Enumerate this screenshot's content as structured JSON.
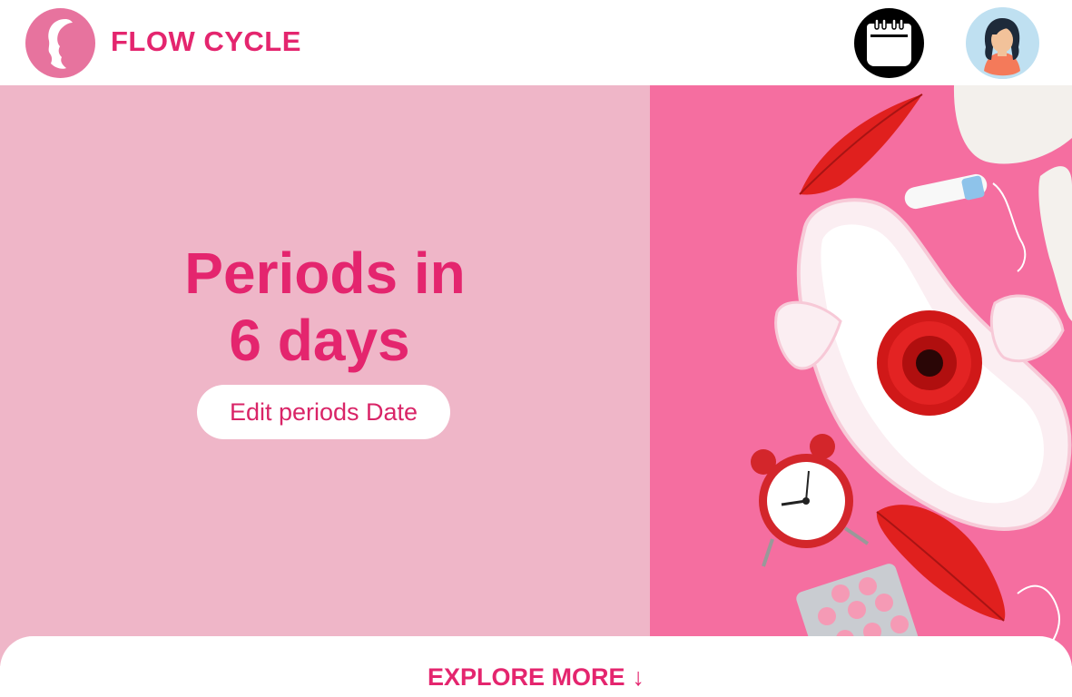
{
  "header": {
    "brand": "FLOW CYCLE",
    "logo_icon": "woman-silhouette-icon",
    "calendar_icon": "calendar-icon",
    "avatar_icon": "user-avatar-icon"
  },
  "hero": {
    "title_line1": "Periods in",
    "title_line2": "6 days",
    "edit_button_label": "Edit periods Date",
    "image_icon": "menstrual-products-photo"
  },
  "footer": {
    "explore_label": "EXPLORE MORE",
    "explore_arrow": "↓"
  },
  "colors": {
    "accent": "#e4256e",
    "hero_left_bg": "#efb6c8",
    "hero_right_bg": "#f56ea0",
    "logo_bg": "#e7739e"
  }
}
